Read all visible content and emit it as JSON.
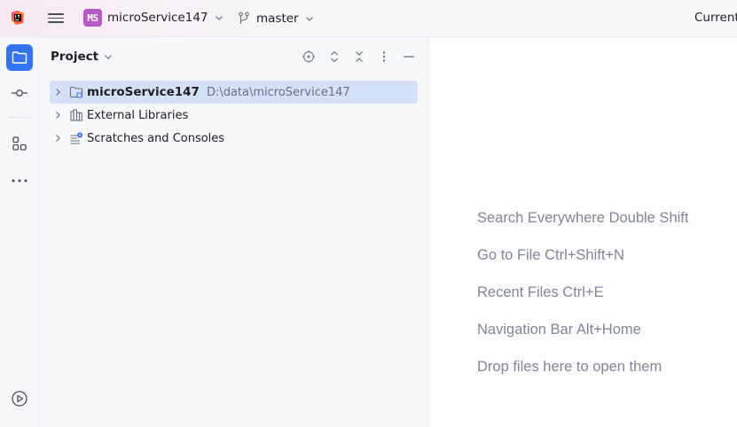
{
  "titlebar": {
    "project_badge": "MS",
    "project_name": "microService147",
    "branch_name": "master",
    "run_config_label": "Current"
  },
  "colors": {
    "accent": "#3574f0",
    "badge": "#b659c5",
    "selection": "#d5e1f8",
    "hint_text": "#818594"
  },
  "toolstrip": {
    "items": [
      {
        "icon": "folder-icon",
        "active": true
      },
      {
        "icon": "commit-icon",
        "active": false
      },
      {
        "icon": "structure-icon",
        "active": false
      },
      {
        "icon": "more-icon",
        "active": false
      },
      {
        "icon": "services-icon",
        "active": false
      }
    ]
  },
  "project_panel": {
    "title": "Project",
    "header_icons": [
      "locate-icon",
      "expand-all-icon",
      "collapse-all-icon",
      "options-icon",
      "hide-icon"
    ],
    "tree": [
      {
        "label": "microService147",
        "path": "D:\\data\\microService147",
        "icon": "module-folder-icon",
        "selected": true
      },
      {
        "label": "External Libraries",
        "icon": "library-icon",
        "selected": false
      },
      {
        "label": "Scratches and Consoles",
        "icon": "scratches-icon",
        "selected": false
      }
    ]
  },
  "editor": {
    "hints": [
      "Search Everywhere Double Shift",
      "Go to File Ctrl+Shift+N",
      "Recent Files Ctrl+E",
      "Navigation Bar Alt+Home",
      "Drop files here to open them"
    ]
  }
}
